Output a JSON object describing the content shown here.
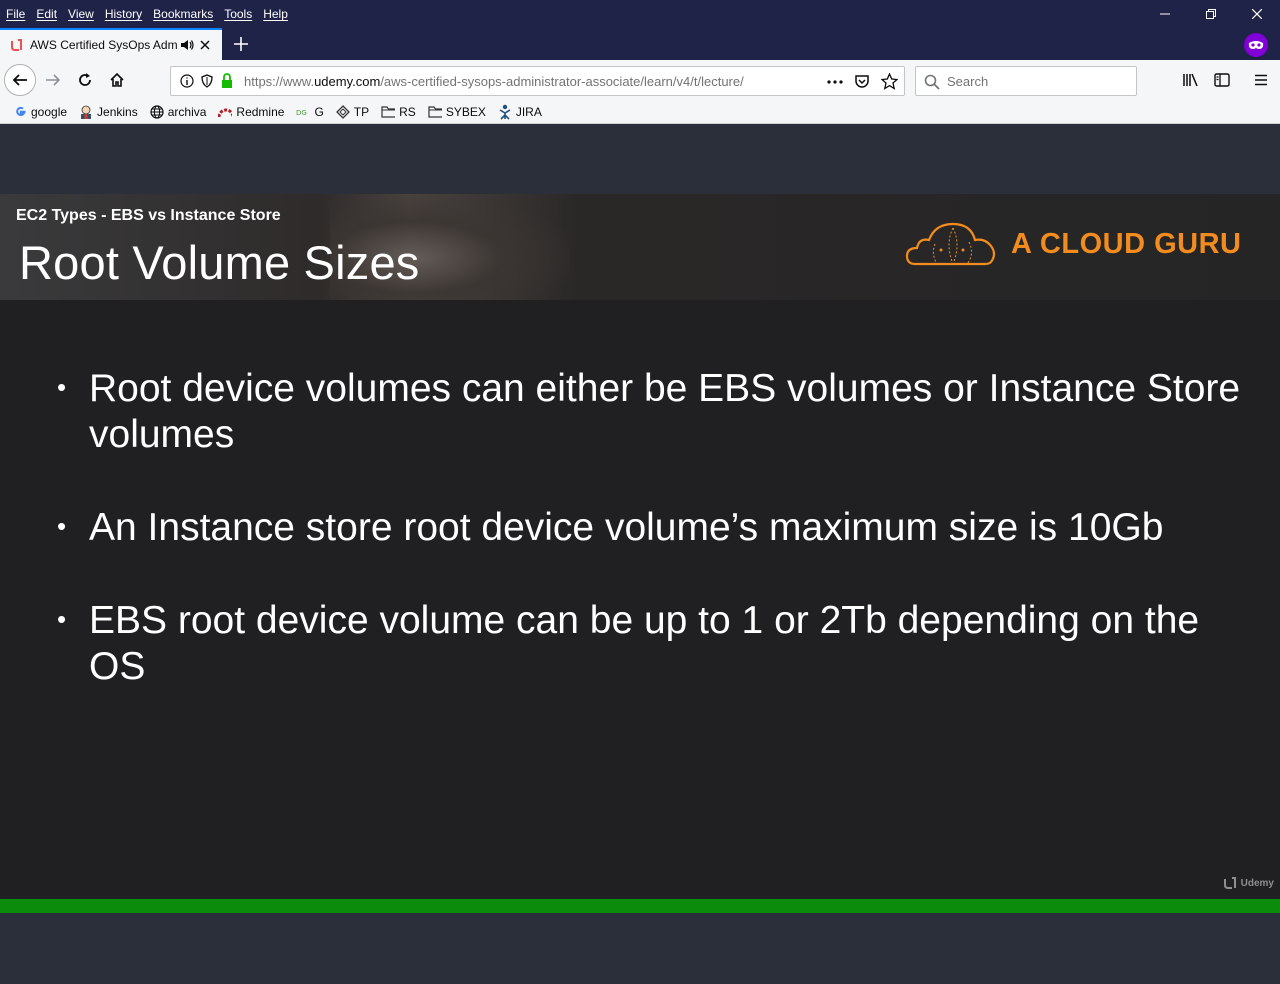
{
  "menu": [
    "File",
    "Edit",
    "View",
    "History",
    "Bookmarks",
    "Tools",
    "Help"
  ],
  "tab": {
    "title": "AWS Certified SysOps Admin"
  },
  "navbar": {
    "url_prefix": "https://www.",
    "url_host": "udemy.com",
    "url_path": "/aws-certified-sysops-administrator-associate/learn/v4/t/lecture/",
    "search_placeholder": "Search"
  },
  "bookmarks": [
    {
      "label": "google",
      "icon": "google-icon"
    },
    {
      "label": "Jenkins",
      "icon": "jenkins-icon"
    },
    {
      "label": "archiva",
      "icon": "globe-icon"
    },
    {
      "label": "Redmine",
      "icon": "redmine-icon"
    },
    {
      "label": "G",
      "icon": "bookmark-icon"
    },
    {
      "label": "TP",
      "icon": "diamond-icon"
    },
    {
      "label": "RS",
      "icon": "folder-icon"
    },
    {
      "label": "SYBEX",
      "icon": "folder-icon"
    },
    {
      "label": "JIRA",
      "icon": "jira-icon"
    }
  ],
  "slide": {
    "subtitle": "EC2 Types - EBS vs Instance Store",
    "title": "Root Volume Sizes",
    "brand": "A CLOUD GURU",
    "bullet_marker": "•",
    "bullets": [
      "Root device volumes can either be EBS volumes or Instance Store volumes",
      "An Instance store root device volume’s maximum size is 10Gb",
      "EBS root device volume can be up to 1 or 2Tb depending on the OS"
    ],
    "watermark": "Udemy"
  },
  "colors": {
    "titlebar": "#1f2347",
    "brand_orange": "#f28c1e",
    "progress_green": "#0b8c0b",
    "private_purple": "#8000d7"
  }
}
